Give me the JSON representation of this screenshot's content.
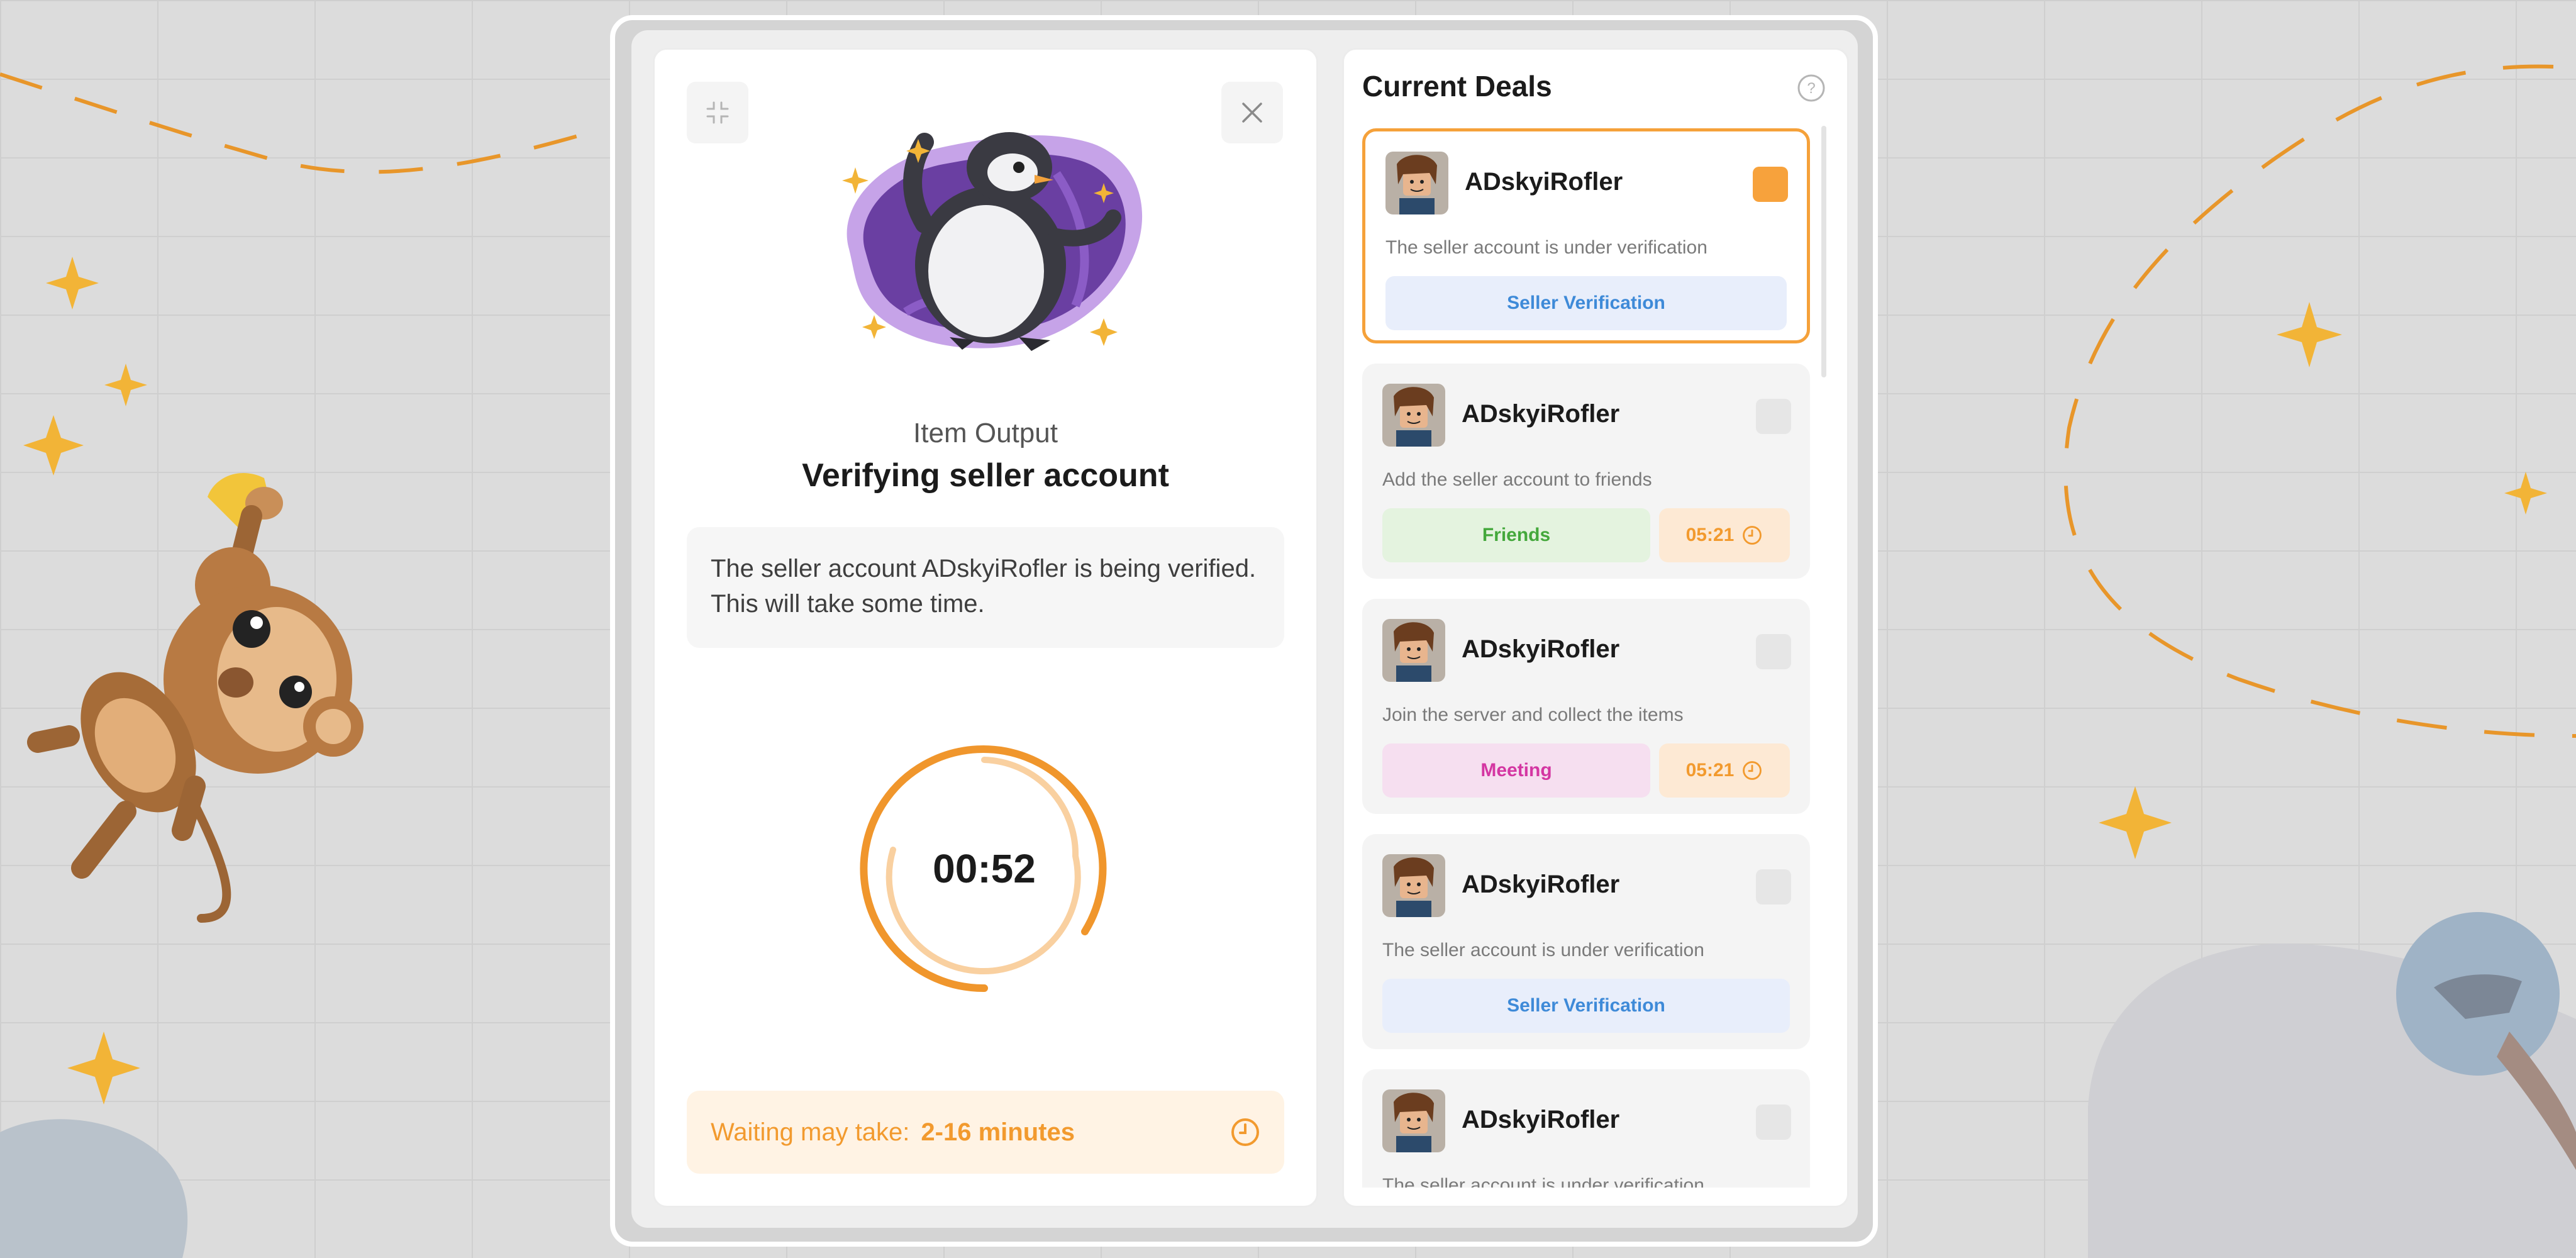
{
  "left": {
    "item_output": "Item Output",
    "title": "Verifying seller account",
    "info": "The seller account ADskyiRofler is being verified. This will take some time.",
    "timer": "00:52",
    "wait_label": "Waiting may take:",
    "wait_value": "2-16 minutes",
    "shrink_icon": "shrink-icon",
    "close_icon": "close-icon"
  },
  "deals": {
    "title": "Current Deals",
    "help_icon": "help-icon",
    "items": [
      {
        "name": "ADskyiRofler",
        "desc": "The seller account is under verification",
        "action": "Seller Verification",
        "selected": true
      },
      {
        "name": "ADskyiRofler",
        "desc": "Add the seller account to friends",
        "action": "Friends",
        "timer": "05:21"
      },
      {
        "name": "ADskyiRofler",
        "desc": "Join the server and collect the items",
        "action": "Meeting",
        "timer": "05:21"
      },
      {
        "name": "ADskyiRofler",
        "desc": "The seller account is under verification",
        "action": "Seller Verification"
      },
      {
        "name": "ADskyiRofler",
        "desc": "The seller account is under verification"
      }
    ]
  },
  "colors": {
    "accent": "#f5a13a",
    "blue": "#3e8ad8",
    "green": "#44a83c",
    "pink": "#d436a2"
  }
}
